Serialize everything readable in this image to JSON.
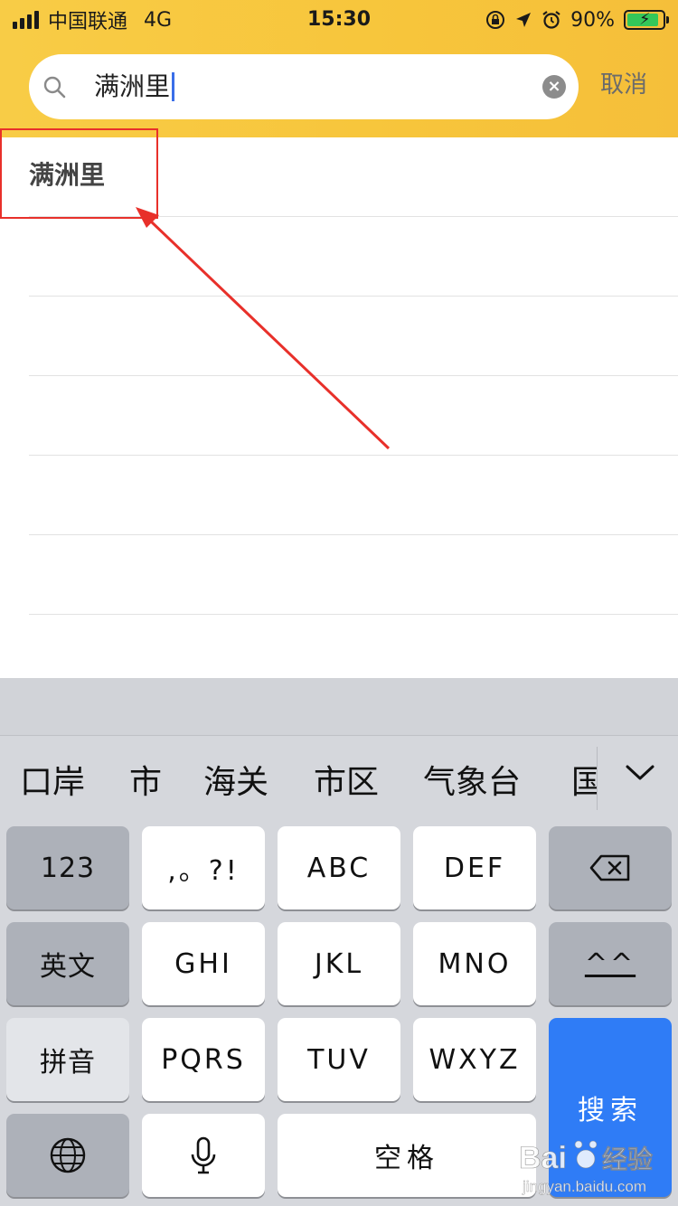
{
  "status_bar": {
    "carrier": "中国联通",
    "network": "4G",
    "time": "15:30",
    "battery_percent": "90%",
    "battery_level": 0.9,
    "icons": [
      "signal-icon",
      "orientation-lock-icon",
      "location-icon",
      "alarm-icon",
      "battery-charging-icon"
    ]
  },
  "search": {
    "value": "满洲里",
    "clear_icon": "×",
    "cancel_label": "取消"
  },
  "results": {
    "items": [
      "满洲里",
      "",
      "",
      "",
      "",
      ""
    ]
  },
  "keyboard": {
    "candidates": [
      "口岸",
      "市",
      "海关",
      "市区",
      "气象台",
      "国"
    ],
    "keys": {
      "num": "123",
      "punct": ",。?!",
      "abc": "ABC",
      "def": "DEF",
      "english": "英文",
      "ghi": "GHI",
      "jkl": "JKL",
      "mno": "MNO",
      "emoji": "^^",
      "pinyin": "拼音",
      "pqrs": "PQRS",
      "tuv": "TUV",
      "wxyz": "WXYZ",
      "search": "搜索",
      "space": "空格"
    }
  },
  "watermark": {
    "brand": "Bai",
    "brand_cn": "经验",
    "url": "jingyan.baidu.com"
  },
  "colors": {
    "header": "#f7c53b",
    "annotation": "#e8302a",
    "search_key": "#2f7cf6"
  }
}
